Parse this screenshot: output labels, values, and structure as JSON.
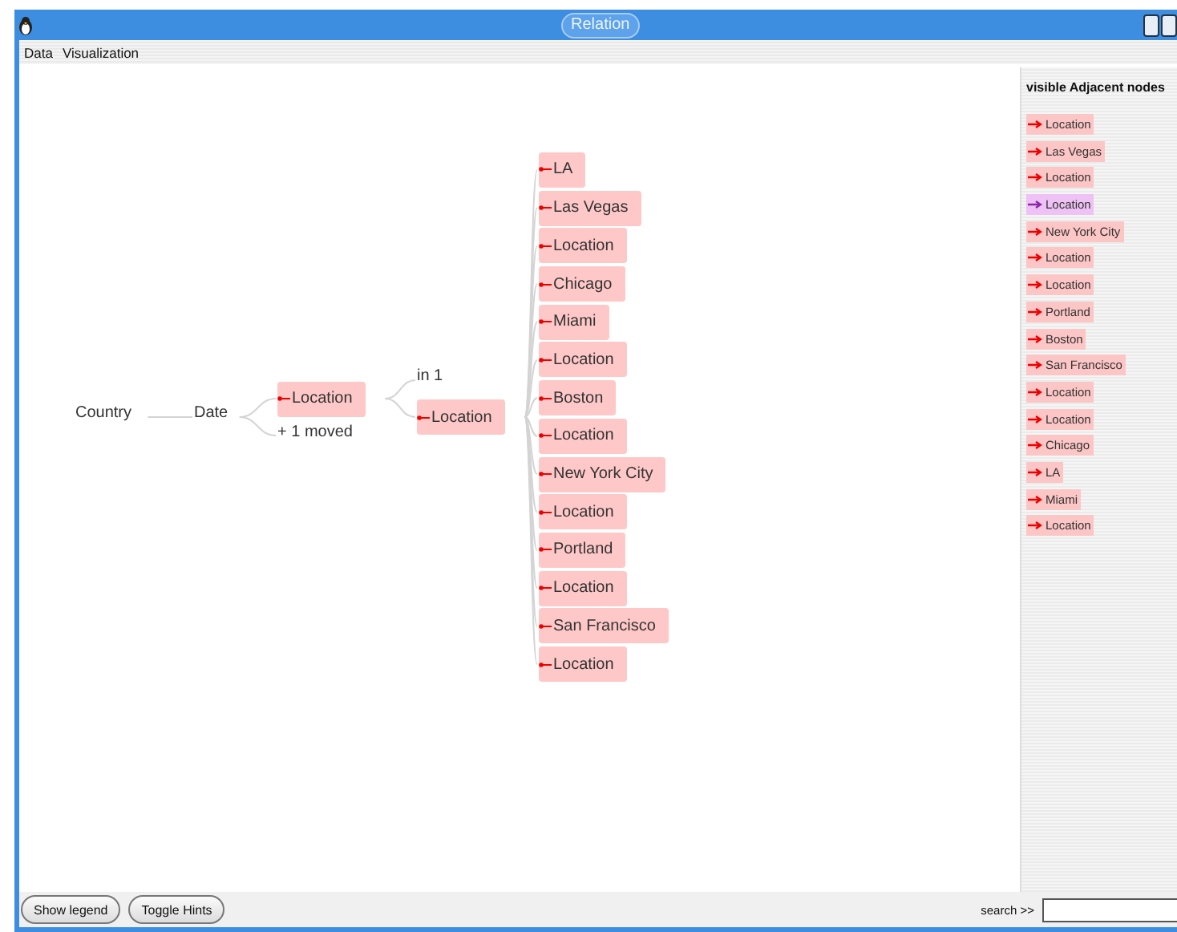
{
  "window": {
    "title": "Relation"
  },
  "menu": [
    {
      "label": "Data"
    },
    {
      "label": "Visualization"
    }
  ],
  "graph": {
    "label": "Country",
    "kind": "text",
    "children": [
      {
        "label": "Date",
        "kind": "text",
        "children": [
          {
            "label": "Location",
            "kind": "node",
            "children": [
              {
                "label": "in 1",
                "kind": "text"
              },
              {
                "label": "Location",
                "kind": "node",
                "children": [
                  {
                    "label": "LA",
                    "kind": "node"
                  },
                  {
                    "label": "Las Vegas",
                    "kind": "node"
                  },
                  {
                    "label": "Location",
                    "kind": "node"
                  },
                  {
                    "label": "Chicago",
                    "kind": "node"
                  },
                  {
                    "label": "Miami",
                    "kind": "node"
                  },
                  {
                    "label": "Location",
                    "kind": "node"
                  },
                  {
                    "label": "Boston",
                    "kind": "node"
                  },
                  {
                    "label": "Location",
                    "kind": "node"
                  },
                  {
                    "label": "New York City",
                    "kind": "node"
                  },
                  {
                    "label": "Location",
                    "kind": "node"
                  },
                  {
                    "label": "Portland",
                    "kind": "node"
                  },
                  {
                    "label": "Location",
                    "kind": "node"
                  },
                  {
                    "label": "San Francisco",
                    "kind": "node"
                  },
                  {
                    "label": "Location",
                    "kind": "node"
                  }
                ]
              }
            ]
          },
          {
            "label": "+ 1 moved",
            "kind": "text"
          }
        ]
      }
    ]
  },
  "side_panel": {
    "title": "visible Adjacent nodes",
    "items": [
      {
        "label": "Location",
        "selected": false
      },
      {
        "label": "Las Vegas",
        "selected": false
      },
      {
        "label": "Location",
        "selected": false
      },
      {
        "label": "Location",
        "selected": true
      },
      {
        "label": "New York City",
        "selected": false
      },
      {
        "label": "Location",
        "selected": false
      },
      {
        "label": "Location",
        "selected": false
      },
      {
        "label": "Portland",
        "selected": false
      },
      {
        "label": "Boston",
        "selected": false
      },
      {
        "label": "San Francisco",
        "selected": false
      },
      {
        "label": "Location",
        "selected": false
      },
      {
        "label": "Location",
        "selected": false
      },
      {
        "label": "Chicago",
        "selected": false
      },
      {
        "label": "LA",
        "selected": false
      },
      {
        "label": "Miami",
        "selected": false
      },
      {
        "label": "Location",
        "selected": false
      }
    ]
  },
  "buttons": [
    {
      "label": "Show legend"
    },
    {
      "label": "Toggle Hints"
    }
  ],
  "search": {
    "label": "search >>"
  }
}
